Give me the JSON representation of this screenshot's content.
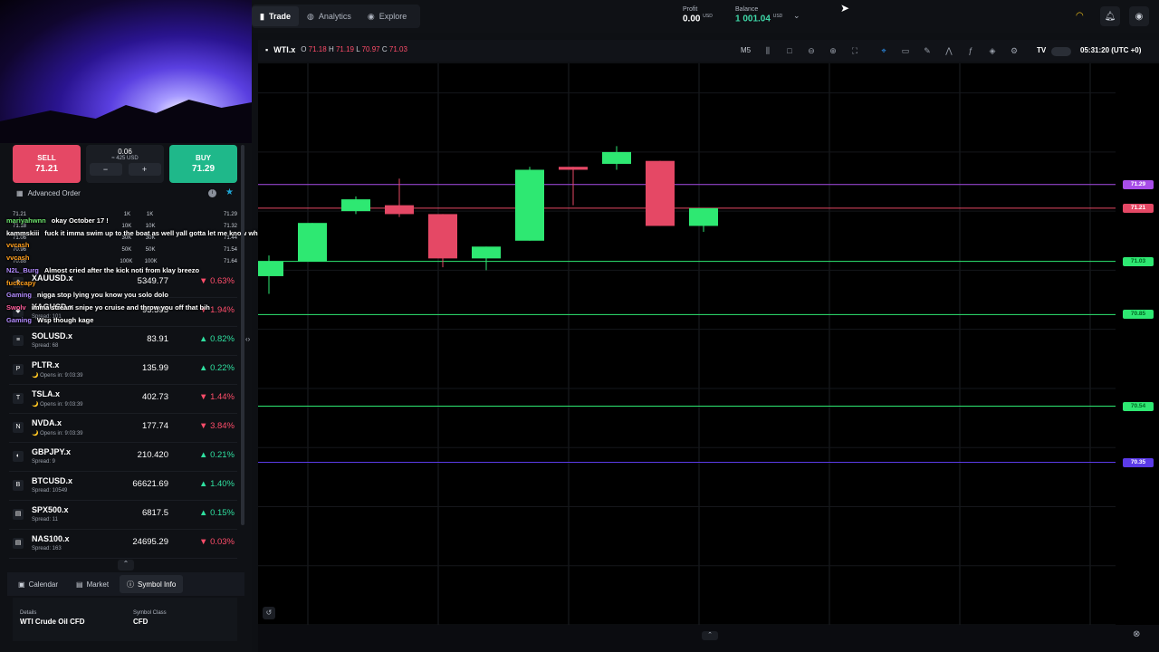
{
  "topbar": {
    "tabs": [
      {
        "label": "Trade",
        "icon": "chart-icon"
      },
      {
        "label": "Analytics",
        "icon": "analytics-icon"
      },
      {
        "label": "Explore",
        "icon": "compass-icon"
      }
    ],
    "profit_label": "Profit",
    "profit_value": "0.00",
    "profit_unit": "USD",
    "balance_label": "Balance",
    "balance_value": "1 001.04",
    "balance_unit": "USD"
  },
  "order": {
    "sell_label": "SELL",
    "sell_price": "71.21",
    "buy_label": "BUY",
    "buy_price": "71.29",
    "quantity": "0.06",
    "quantity_value": "≈ 425 USD",
    "minus": "−",
    "plus": "+",
    "advanced_label": "Advanced Order"
  },
  "depth": [
    {
      "bid": "71.21",
      "vol_l": "1K",
      "vol_r": "1K",
      "ask": "71.29"
    },
    {
      "bid": "71.18",
      "vol_l": "10K",
      "vol_r": "10K",
      "ask": "71.32"
    },
    {
      "bid": "71.06",
      "vol_l": "30K",
      "vol_r": "30K",
      "ask": "71.44"
    },
    {
      "bid": "70.96",
      "vol_l": "50K",
      "vol_r": "50K",
      "ask": "71.54"
    },
    {
      "bid": "70.86",
      "vol_l": "100K",
      "vol_r": "100K",
      "ask": "71.64"
    }
  ],
  "chat": [
    {
      "name": "mariyahwnn",
      "color": "#6de36d",
      "text": "okay October 17 !"
    },
    {
      "name": "kammskiii",
      "color": "#ffffff",
      "text": "fuck it imma swim up to the boat as well yall gotta let me know which one yall taking 😂"
    },
    {
      "name": "vvcash",
      "color": "#ff9f1c",
      "text": ""
    },
    {
      "name": "vvcash",
      "color": "#ff9f1c",
      "text": ""
    },
    {
      "name": "N2L_Burg",
      "color": "#b38cff",
      "text": "Almost cried after the kick noti from klay breezo"
    },
    {
      "name": "fuckcapy",
      "color": "#ff9f1c",
      "text": ""
    },
    {
      "name": "Gaming",
      "color": "#b38cff",
      "text": "nigga stop lying you know you solo dolo"
    },
    {
      "name": "Swolv",
      "color": "#ff5c9a",
      "text": "imma stream snipe yo cruise and throw you off that bih"
    },
    {
      "name": "Gaming",
      "color": "#b38cff",
      "text": "Wsp though kage"
    }
  ],
  "symbols": [
    {
      "name": "XAUUSD.x",
      "sub": "",
      "price": "5349.77",
      "change": "0.63%",
      "dir": "dn",
      "icon": "gold-icon",
      "glyph": "◆"
    },
    {
      "name": "XAGUSD.x",
      "sub": "Spread: 101",
      "price": "93.595",
      "change": "1.94%",
      "dir": "dn",
      "icon": "silver-icon",
      "glyph": "◆"
    },
    {
      "name": "SOLUSD.x",
      "sub": "Spread: 68",
      "price": "83.91",
      "change": "0.82%",
      "dir": "up",
      "icon": "solana-icon",
      "glyph": "≡"
    },
    {
      "name": "PLTR.x",
      "sub": "🌙 Opens in: 9:03:39",
      "price": "135.99",
      "change": "0.22%",
      "dir": "up",
      "icon": "palantir-icon",
      "glyph": "P"
    },
    {
      "name": "TSLA.x",
      "sub": "🌙 Opens in: 9:03:39",
      "price": "402.73",
      "change": "1.44%",
      "dir": "dn",
      "icon": "tesla-icon",
      "glyph": "T"
    },
    {
      "name": "NVDA.x",
      "sub": "🌙 Opens in: 9:03:39",
      "price": "177.74",
      "change": "3.84%",
      "dir": "dn",
      "icon": "nvidia-icon",
      "glyph": "N"
    },
    {
      "name": "GBPJPY.x",
      "sub": "Spread: 9",
      "price": "210.420",
      "change": "0.21%",
      "dir": "up",
      "icon": "uk-flag-icon",
      "glyph": "◐"
    },
    {
      "name": "BTCUSD.x",
      "sub": "Spread: 10549",
      "price": "66621.69",
      "change": "1.40%",
      "dir": "up",
      "icon": "bitcoin-icon",
      "glyph": "B"
    },
    {
      "name": "SPX500.x",
      "sub": "Spread: 11",
      "price": "6817.5",
      "change": "0.15%",
      "dir": "up",
      "icon": "us-flag-icon",
      "glyph": "▤"
    },
    {
      "name": "NAS100.x",
      "sub": "Spread: 163",
      "price": "24695.29",
      "change": "0.03%",
      "dir": "dn",
      "icon": "us-flag-icon",
      "glyph": "▤"
    }
  ],
  "bottom": {
    "tabs": [
      {
        "label": "Calendar",
        "icon": "calendar-icon"
      },
      {
        "label": "Market",
        "icon": "market-icon"
      },
      {
        "label": "Symbol Info",
        "icon": "info-icon"
      }
    ],
    "details_label": "Details",
    "details_value": "WTI Crude Oil CFD",
    "class_label": "Symbol Class",
    "class_value": "CFD"
  },
  "chart": {
    "symbol": "WTI.x",
    "o_label": "O",
    "o": "71.18",
    "h_label": "H",
    "h": "71.19",
    "l_label": "L",
    "l": "70.97",
    "c_label": "C",
    "c": "71.03",
    "timeframe": "M5",
    "clock": "05:31:20 (UTC +0)"
  },
  "chart_data": {
    "type": "candlestick",
    "candles": [
      {
        "o": 70.98,
        "h": 71.05,
        "l": 70.92,
        "c": 71.03
      },
      {
        "o": 71.03,
        "h": 71.16,
        "l": 71.03,
        "c": 71.16
      },
      {
        "o": 71.2,
        "h": 71.25,
        "l": 71.19,
        "c": 71.24
      },
      {
        "o": 71.22,
        "h": 71.31,
        "l": 71.18,
        "c": 71.19
      },
      {
        "o": 71.19,
        "h": 71.19,
        "l": 71.01,
        "c": 71.04
      },
      {
        "o": 71.04,
        "h": 71.08,
        "l": 71.0,
        "c": 71.08
      },
      {
        "o": 71.1,
        "h": 71.35,
        "l": 71.1,
        "c": 71.34
      },
      {
        "o": 71.35,
        "h": 71.35,
        "l": 71.22,
        "c": 71.34
      },
      {
        "o": 71.36,
        "h": 71.42,
        "l": 71.34,
        "c": 71.4
      },
      {
        "o": 71.37,
        "h": 71.37,
        "l": 71.15,
        "c": 71.15
      },
      {
        "o": 71.15,
        "h": 71.21,
        "l": 71.13,
        "c": 71.21
      }
    ],
    "ylim": [
      69.8,
      71.7
    ],
    "price_lines": [
      {
        "value": "71.29",
        "color": "#a74de8"
      },
      {
        "value": "71.21",
        "color": "#e54865"
      },
      {
        "value": "71.03",
        "color": "#2ee872"
      },
      {
        "value": "70.85",
        "color": "#2ee872"
      },
      {
        "value": "70.54",
        "color": "#2ee872"
      },
      {
        "value": "70.35",
        "color": "#5b3be8"
      }
    ]
  }
}
